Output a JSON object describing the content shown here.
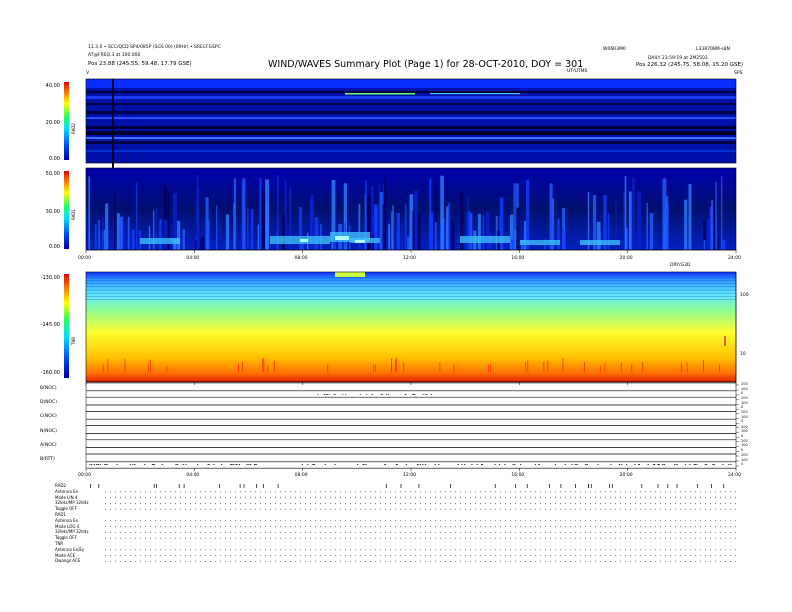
{
  "header": {
    "title": "WIND/WAVES Summary Plot (Page 1) for 28-OCT-2010, DOY = 301",
    "left_line1": "11.3.0 • SCC/QCD SP4/085P (SGS 00) (09Hr) • SRECFGSPC",
    "left_line2": "AT@FREQ.3 at 100.000",
    "left_pos": "Pos    23.88 (245.55, 59.48, 17.79 GSE)",
    "right_code": "W06R3M0",
    "right_id": "L33870BM-s8N",
    "right_line2": "DAILY  23:59:19 at 2M2503",
    "right_pos": "Pos    226.32 (245.75, 58.08, 15.20 GSE)",
    "ut_label": "UT/UTMS",
    "marker_left": "V",
    "marker_right": "SPS"
  },
  "panels": {
    "rad2": {
      "label": "RAD2",
      "ticks": [
        "40.00",
        "20.00",
        "0.00"
      ],
      "range": [
        0,
        40
      ]
    },
    "rad1": {
      "label": "RAD1",
      "ticks": [
        "50.00",
        "30.00",
        "0.00"
      ],
      "range": [
        0,
        50
      ]
    },
    "tnr": {
      "label": "TNR",
      "ticks": [
        "-130.00",
        "-145.00",
        "-160.00"
      ],
      "range": [
        -160,
        -130
      ],
      "right_ticks": [
        "100",
        "10"
      ],
      "right_header": "DRY/G3D"
    },
    "lines": [
      {
        "label": "B(NOC)",
        "right_ticks": [
          "200",
          "100",
          "0"
        ]
      },
      {
        "label": "D(NOC)",
        "right_ticks": [
          "200",
          "100",
          "0"
        ]
      },
      {
        "label": "C(NOC)",
        "right_ticks": [
          "200",
          "100",
          "0"
        ]
      },
      {
        "label": "N(NOC)",
        "right_ticks": [
          "200",
          "100",
          "0"
        ]
      },
      {
        "label": "A(NOC)",
        "right_ticks": [
          "200",
          "100",
          "0"
        ]
      },
      {
        "label": "B(RTT)",
        "right_ticks": [
          "200",
          "100",
          "0"
        ]
      }
    ]
  },
  "time_ticks": [
    "00:00",
    "04:00",
    "08:00",
    "12:00",
    "16:00",
    "20:00",
    "24:00"
  ],
  "footer": {
    "rad2": [
      "RAD2",
      "Antenna   Ex",
      "Mode   LIN 4",
      "32kHz/MP  32kHz",
      "Toggle   OFF"
    ],
    "rad1": [
      "RAD1",
      "Antenna   Ex",
      "Mode   LOG 4",
      "32kHz/MP  32kHz",
      "Toggle   OFF"
    ],
    "tnr": [
      "TNR",
      "Antenna  Ex/Ey",
      "Mode   ACE",
      "Dwangs   ACE"
    ]
  },
  "colors": {
    "bg": "#000a8c",
    "band_dark": "#000045",
    "line": "#000000"
  },
  "chart_data": [
    {
      "type": "heatmap",
      "title": "RAD2",
      "x_range": [
        "00:00",
        "24:00"
      ],
      "ylim": [
        0,
        40
      ],
      "ylabel": "RAD2",
      "colorbar": "rainbow",
      "description_values": [
        0,
        20,
        40
      ]
    },
    {
      "type": "heatmap",
      "title": "RAD1",
      "x_range": [
        "00:00",
        "24:00"
      ],
      "ylim": [
        0,
        50
      ],
      "ylabel": "RAD1",
      "colorbar": "rainbow",
      "description_values": [
        0,
        30,
        50
      ]
    },
    {
      "type": "heatmap",
      "title": "TNR",
      "x_range": [
        "00:00",
        "24:00"
      ],
      "ylim": [
        -160,
        -130
      ],
      "ylabel": "TNR",
      "colorbar": "rainbow",
      "description_values": [
        -160,
        -145,
        -130
      ]
    },
    {
      "type": "line",
      "series": [
        {
          "name": "B(NOC)"
        },
        {
          "name": "D(NOC)"
        },
        {
          "name": "C(NOC)"
        },
        {
          "name": "N(NOC)"
        },
        {
          "name": "A(NOC)"
        },
        {
          "name": "B(RTT)"
        }
      ],
      "x_range": [
        "00:00",
        "24:00"
      ],
      "ylim": [
        0,
        200
      ]
    }
  ]
}
